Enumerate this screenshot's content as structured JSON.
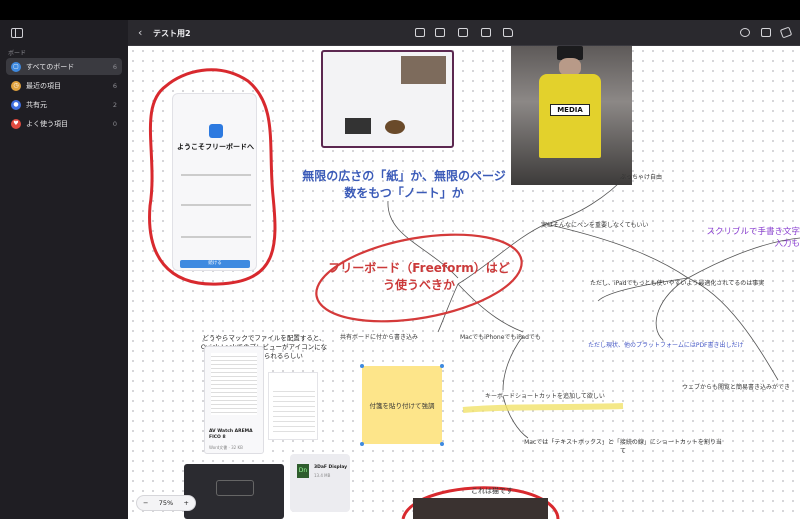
{
  "toolbar": {
    "title": "テスト用2"
  },
  "sidebar": {
    "header": "ボード",
    "items": [
      {
        "label": "すべてのボード",
        "count": "6",
        "color": "#3f8ae0"
      },
      {
        "label": "最近の項目",
        "count": "6",
        "color": "#e0a23f"
      },
      {
        "label": "共有元",
        "count": "2",
        "color": "#3f6fe0"
      },
      {
        "label": "よく使う項目",
        "count": "0",
        "color": "#e04a3f"
      }
    ]
  },
  "canvas": {
    "welcome_title": "ようこそフリーボードへ",
    "welcome_button": "続ける",
    "blue_text": "無限の広さの「紙」か、無限のページ数をもつ「ノート」か",
    "red_text": "フリーボード（Freeform）はどう使うべきか",
    "media_label": "MEDIA",
    "nodes": {
      "n1": "ぶっちゃけ自由",
      "n2": "実はそんなにペンを重要しなくてもいい",
      "n3": "ただし、iPadでもっとも使いやすいよう最適化されてるのは事実",
      "n4": "共有ボードに付から書き込み",
      "n5": "MacでもiPhoneでもiPadでも",
      "n6": "キーボードショートカットを追加して欲しい",
      "n7": "Macでは「テキストボックス」と「接続の線」にショートカットを割り当て",
      "n8": "ウェブからも閲覧と簡易書き込みができ",
      "n9": "これは猫です"
    },
    "purple_text": "スクリブルで手書き文字入力も",
    "blue_note": "ただし現状、他のプラットフォームにはPDF書き出しだけ",
    "quicklook_text": "どうやらマックでファイルを配置すると、Quick Lookでのプレビューがアイコンになって貼り付けられるらしい",
    "sticky_text": "付箋を貼り付けて強調",
    "doc_title": "AV Watch AREMA FICO 8",
    "doc_meta": "Word文書 · 32 KB",
    "file3d_title": "3DaF Display",
    "file3d_meta": "13.4 MB",
    "zoom": {
      "minus": "−",
      "value": "75%",
      "plus": "+"
    }
  }
}
